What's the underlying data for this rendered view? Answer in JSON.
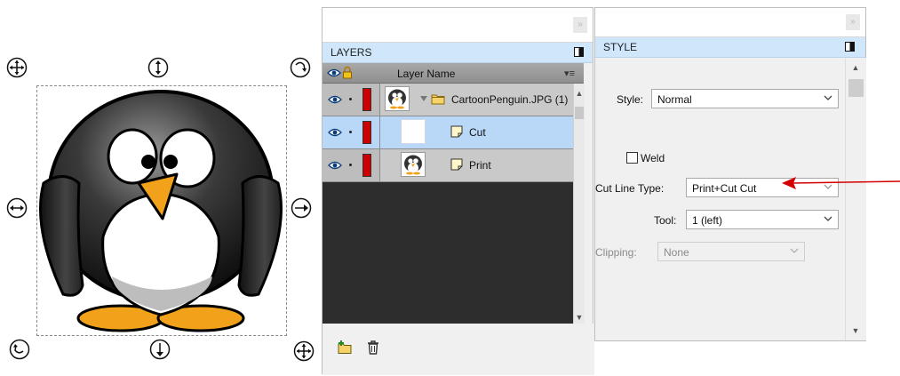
{
  "canvas": {
    "object_name": "CartoonPenguin.JPG"
  },
  "layers_panel": {
    "title": "LAYERS",
    "column_header": "Layer Name",
    "layers": [
      {
        "label": "CartoonPenguin.JPG (1)",
        "type": "group",
        "selected": false
      },
      {
        "label": "Cut",
        "type": "layer",
        "selected": true
      },
      {
        "label": "Print",
        "type": "layer",
        "selected": false
      }
    ]
  },
  "style_panel": {
    "title": "STYLE",
    "style_label": "Style:",
    "style_value": "Normal",
    "weld_label": "Weld",
    "weld_checked": false,
    "cut_line_type_label": "Cut Line Type:",
    "cut_line_type_value": "Print+Cut Cut",
    "tool_label": "Tool:",
    "tool_value": "1 (left)",
    "clipping_label": "Clipping:",
    "clipping_value": "None"
  },
  "colors": {
    "selection_blue": "#b9d8f7",
    "panel_header_blue": "#cfe6fb",
    "layer_color_red": "#cc0000",
    "annotation_arrow": "#d40000"
  }
}
